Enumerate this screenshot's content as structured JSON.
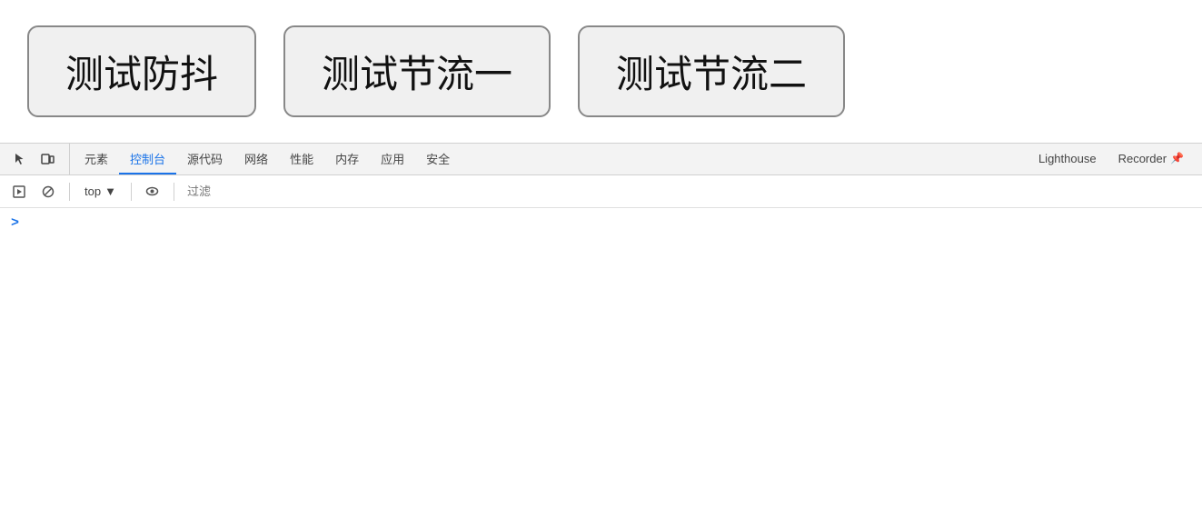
{
  "buttons": [
    {
      "label": "测试防抖",
      "id": "btn-debounce"
    },
    {
      "label": "测试节流一",
      "id": "btn-throttle1"
    },
    {
      "label": "测试节流二",
      "id": "btn-throttle2"
    }
  ],
  "devtools": {
    "tabs": [
      {
        "label": "元素",
        "id": "elements",
        "active": false
      },
      {
        "label": "控制台",
        "id": "console",
        "active": true
      },
      {
        "label": "源代码",
        "id": "sources",
        "active": false
      },
      {
        "label": "网络",
        "id": "network",
        "active": false
      },
      {
        "label": "性能",
        "id": "performance",
        "active": false
      },
      {
        "label": "内存",
        "id": "memory",
        "active": false
      },
      {
        "label": "应用",
        "id": "application",
        "active": false
      },
      {
        "label": "安全",
        "id": "security",
        "active": false
      },
      {
        "label": "Lighthouse",
        "id": "lighthouse",
        "active": false
      },
      {
        "label": "Recorder",
        "id": "recorder",
        "active": false
      }
    ]
  },
  "console_toolbar": {
    "top_label": "top",
    "filter_placeholder": "过滤",
    "eye_icon": "👁",
    "block_icon": "🚫"
  },
  "console_content": {
    "prompt_char": ">"
  },
  "icons": {
    "cursor": "↖",
    "layers": "❐",
    "play": "▶",
    "block": "⊘",
    "eye": "◉",
    "chevron_right": ">",
    "chevron_down": "▼",
    "pin": "📌"
  }
}
